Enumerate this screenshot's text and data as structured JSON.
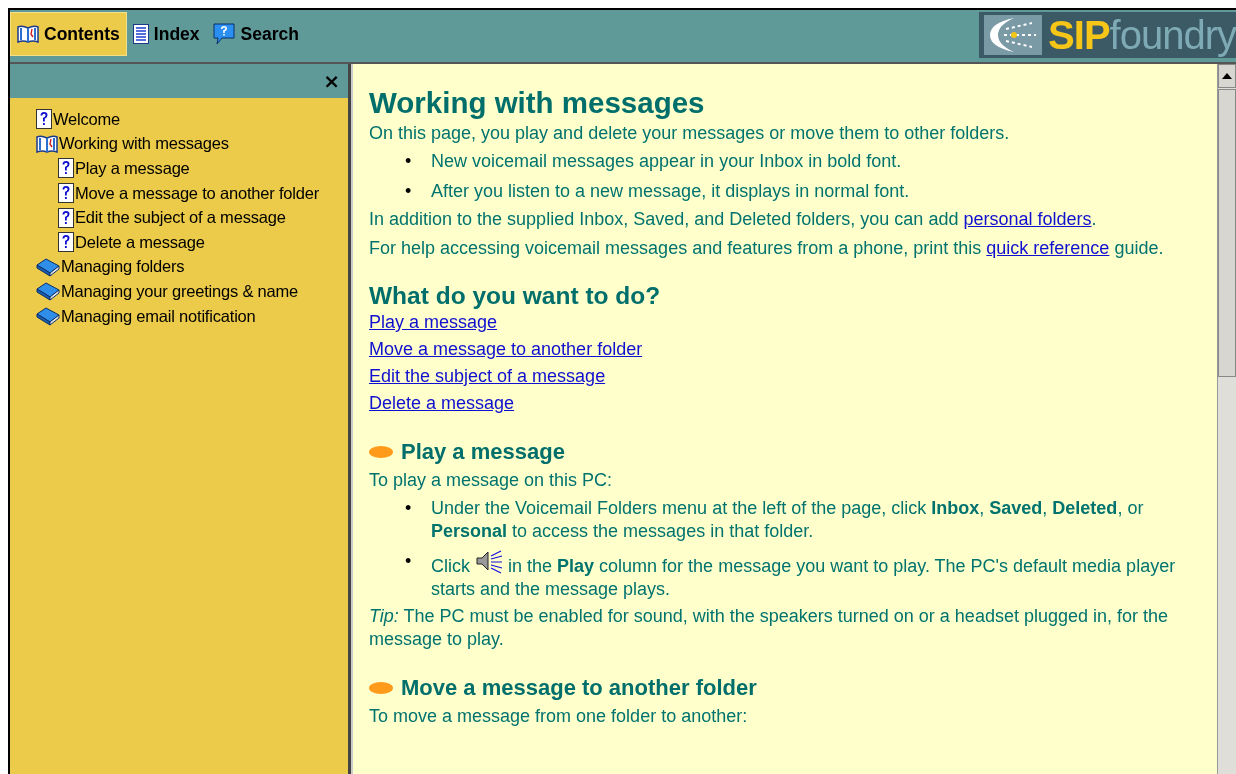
{
  "tabs": [
    {
      "label": "Contents",
      "kind": "contents",
      "selected": true
    },
    {
      "label": "Index",
      "kind": "index",
      "selected": false
    },
    {
      "label": "Search",
      "kind": "search",
      "selected": false
    }
  ],
  "logo": {
    "brand_bold": "SIP",
    "brand_light": "foundry"
  },
  "sidebar": {
    "close": "×",
    "items": [
      {
        "label": "Welcome",
        "kind": "topic"
      },
      {
        "label": "Working with messages",
        "kind": "book",
        "expanded": true,
        "children": [
          {
            "label": "Play a message",
            "kind": "topic"
          },
          {
            "label": "Move a message to another folder",
            "kind": "topic"
          },
          {
            "label": "Edit the subject of a message",
            "kind": "topic"
          },
          {
            "label": "Delete a message",
            "kind": "topic"
          }
        ]
      },
      {
        "label": "Managing folders",
        "kind": "book",
        "expanded": false
      },
      {
        "label": "Managing your greetings & name",
        "kind": "book",
        "expanded": false
      },
      {
        "label": "Managing email notification",
        "kind": "book",
        "expanded": false
      }
    ]
  },
  "content": [
    {
      "kind": "title",
      "text": "Working with messages"
    },
    {
      "kind": "para",
      "parts": [
        {
          "kind": "text",
          "text": "On this page, you play and delete your messages or move them to other folders."
        }
      ]
    },
    {
      "kind": "bullets",
      "items": [
        {
          "marker": "•",
          "parts": [
            {
              "kind": "text",
              "text": "New voicemail messages appear in your Inbox in bold font."
            }
          ]
        },
        {
          "marker": "•",
          "parts": [
            {
              "kind": "text",
              "text": "After you listen to a new message, it displays in normal font."
            }
          ]
        }
      ]
    },
    {
      "kind": "para",
      "parts": [
        {
          "kind": "text",
          "text": "In addition to the supplied Inbox, Saved, and Deleted folders, you can add "
        },
        {
          "kind": "link",
          "text": "personal folders"
        },
        {
          "kind": "text",
          "text": "."
        }
      ]
    },
    {
      "kind": "para",
      "parts": [
        {
          "kind": "text",
          "text": "For help accessing voicemail messages and features from a phone, print this "
        },
        {
          "kind": "link",
          "text": "quick reference"
        },
        {
          "kind": "text",
          "text": " guide."
        }
      ]
    },
    {
      "kind": "heading",
      "text": "What do you want to do?"
    },
    {
      "kind": "links",
      "items": [
        "Play a message",
        "Move a message to another folder",
        "Edit the subject of a message",
        "Delete a message"
      ]
    },
    {
      "kind": "section",
      "text": "Play a message"
    },
    {
      "kind": "para",
      "parts": [
        {
          "kind": "text",
          "text": "To play a message on this PC:"
        }
      ]
    },
    {
      "kind": "bullets",
      "items": [
        {
          "marker": "•",
          "parts": [
            {
              "kind": "text",
              "text": "Under the Voicemail Folders menu at the left of the page, click **Inbox**, **Saved**, **Deleted**, or **Personal** to access the messages in that folder."
            }
          ]
        },
        {
          "marker": "•",
          "parts": [
            {
              "kind": "text",
              "text": "Click "
            },
            {
              "kind": "speaker"
            },
            {
              "kind": "text",
              "text": " in the **Play** column for the message you want to play. The PC's default media player starts and the message plays."
            }
          ]
        }
      ]
    },
    {
      "kind": "para",
      "parts": [
        {
          "kind": "text",
          "text": "*Tip:* The PC must be enabled for sound, with the speakers turned on or a headset plugged in, for the message to play."
        }
      ]
    },
    {
      "kind": "section",
      "text": "Move a message to another folder"
    },
    {
      "kind": "para",
      "parts": [
        {
          "kind": "text",
          "text": "To move a message from one folder to another:"
        }
      ]
    }
  ]
}
